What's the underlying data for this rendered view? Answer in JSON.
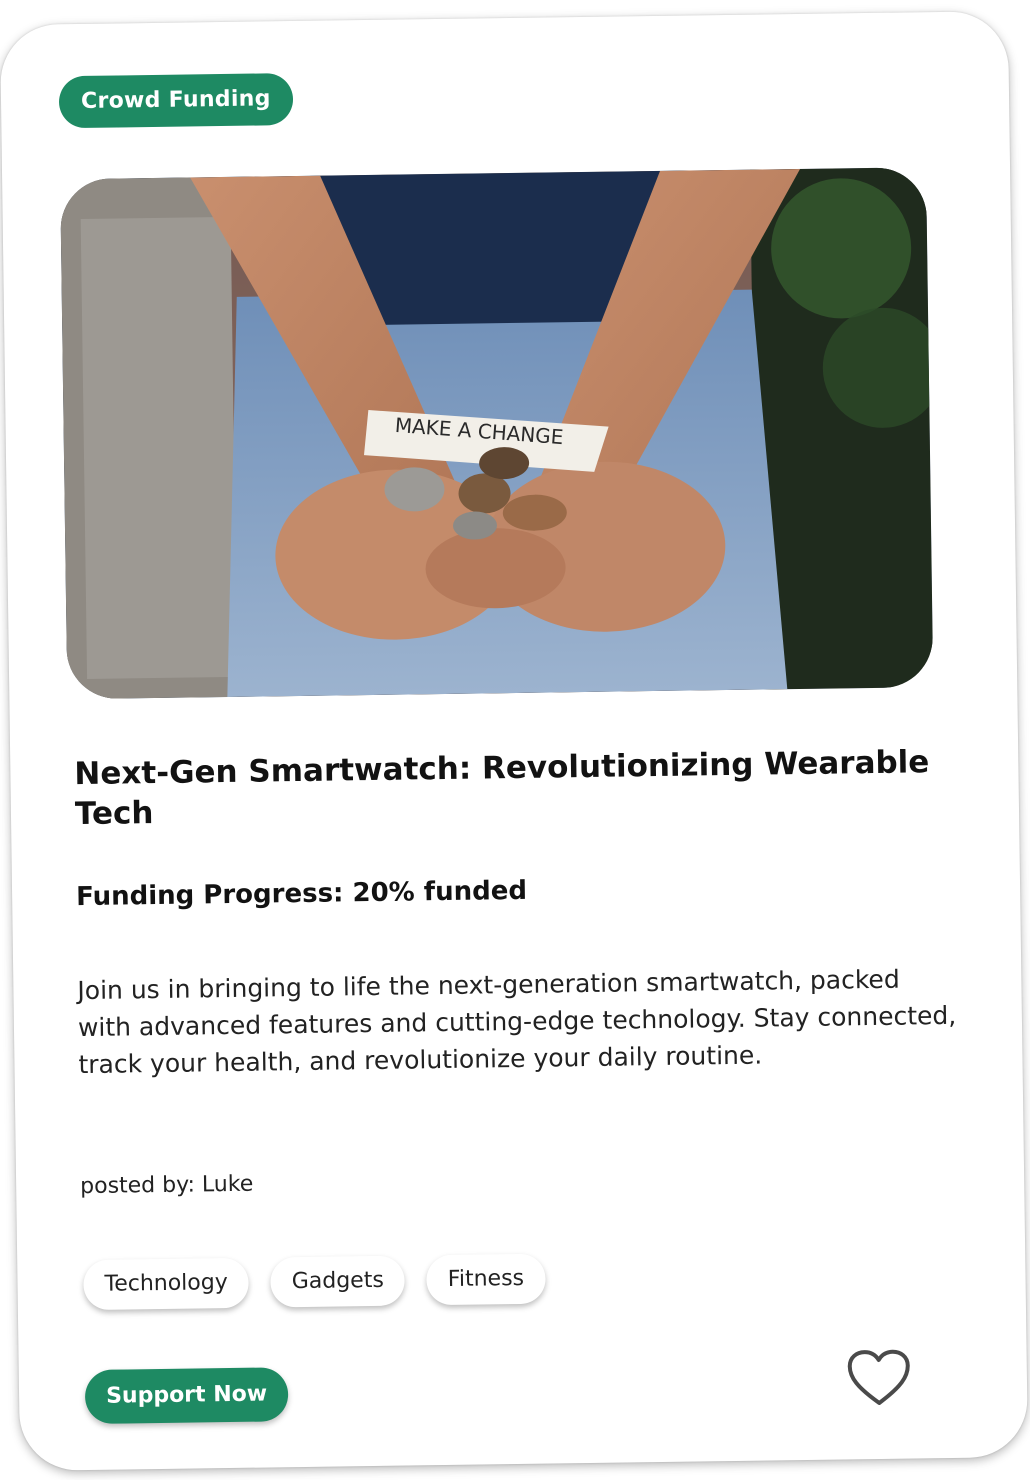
{
  "card": {
    "badge": "Crowd Funding",
    "hero_note_text": "MAKE A CHANGE",
    "title": "Next-Gen Smartwatch: Revolutionizing Wearable Tech",
    "funding_progress": "Funding Progress: 20% funded",
    "funding_percent": 20,
    "description": "Join us in bringing to life the next-generation smartwatch, packed with advanced features and cutting-edge technology. Stay connected, track your health, and revolutionize your daily routine.",
    "posted_by": "posted by: Luke",
    "tags": [
      "Technology",
      "Gadgets",
      "Fitness"
    ],
    "support_label": "Support Now",
    "favorite_icon": "heart-icon"
  },
  "colors": {
    "accent": "#1e8a63",
    "text": "#121212"
  }
}
